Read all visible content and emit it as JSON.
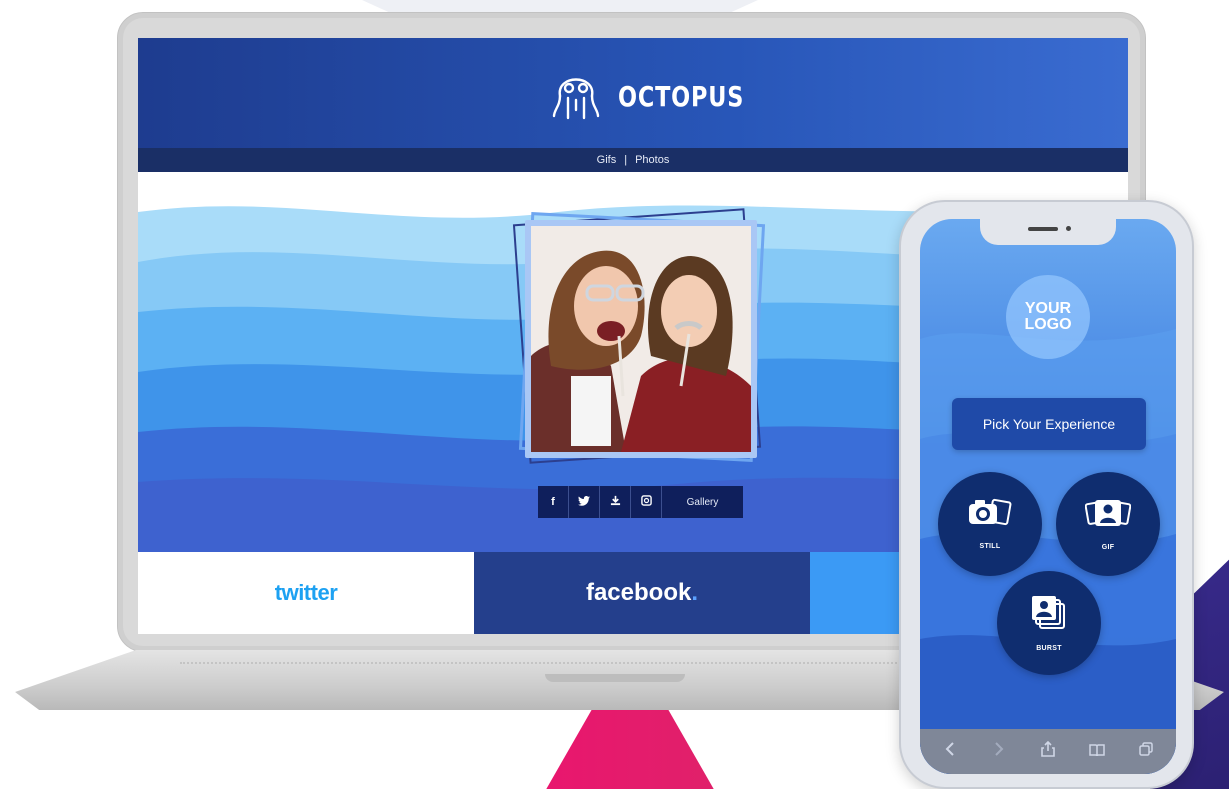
{
  "site": {
    "brand": "OCTOPUS",
    "nav": {
      "gifs": "Gifs",
      "sep": "|",
      "photos": "Photos"
    },
    "share": {
      "facebook": "f",
      "gallery": "Gallery"
    }
  },
  "social": {
    "twitter": "twitter",
    "facebook": "facebook",
    "facebook_dot": "."
  },
  "phone": {
    "logo_line1": "YOUR",
    "logo_line2": "LOGO",
    "pick": "Pick Your Experience",
    "modes": {
      "still": "STILL",
      "gif": "GIF",
      "burst": "BURST"
    }
  },
  "colors": {
    "header": "#1e3c8f",
    "subnav": "#1a2f66",
    "facebook": "#243f8c",
    "twitter": "#1da1f2",
    "accent_pink": "#e9166e",
    "accent_purple": "#3a2c8f"
  }
}
